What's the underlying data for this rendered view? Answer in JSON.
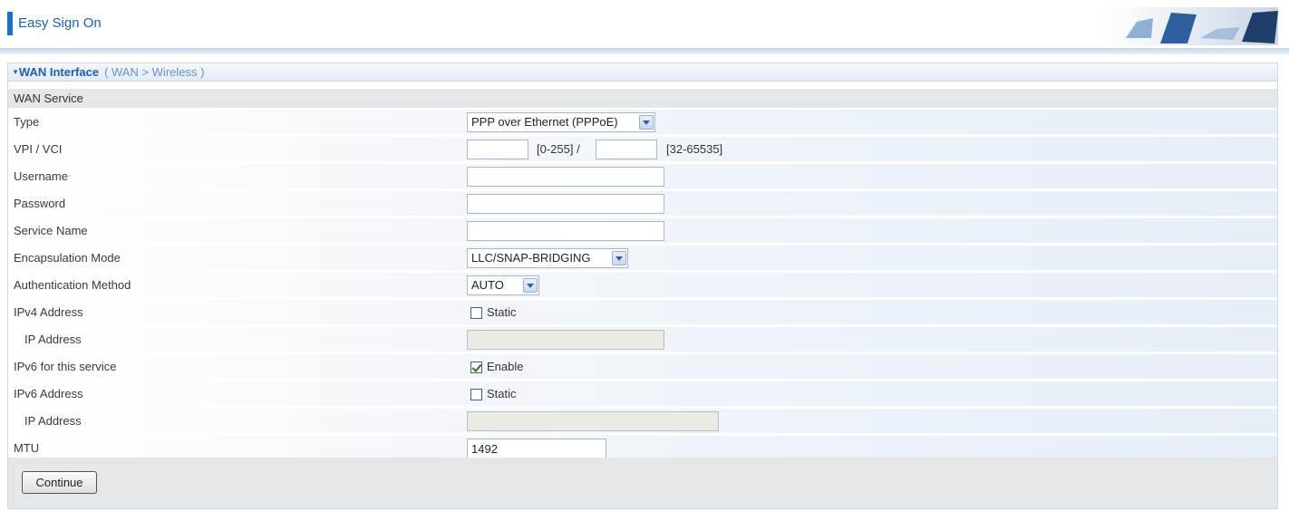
{
  "header": {
    "title": "Easy Sign On"
  },
  "panel": {
    "title": "WAN Interface",
    "breadcrumb": "( WAN > Wireless )",
    "section_title": "WAN Service"
  },
  "form": {
    "type": {
      "label": "Type",
      "value": "PPP over Ethernet (PPPoE)"
    },
    "vpi_vci": {
      "label": "VPI / VCI",
      "vpi_value": "",
      "vpi_range": "[0-255] /",
      "vci_value": "",
      "vci_range": "[32-65535]"
    },
    "username": {
      "label": "Username",
      "value": ""
    },
    "password": {
      "label": "Password",
      "value": ""
    },
    "service_name": {
      "label": "Service Name",
      "value": ""
    },
    "encapsulation": {
      "label": "Encapsulation Mode",
      "value": "LLC/SNAP-BRIDGING"
    },
    "auth": {
      "label": "Authentication Method",
      "value": "AUTO"
    },
    "ipv4": {
      "label": "IPv4 Address",
      "checkbox_label": "Static",
      "checked": false
    },
    "ipv4_ip": {
      "label": "IP Address",
      "value": ""
    },
    "ipv6_service": {
      "label": "IPv6 for this service",
      "checkbox_label": "Enable",
      "checked": true
    },
    "ipv6": {
      "label": "IPv6 Address",
      "checkbox_label": "Static",
      "checked": false
    },
    "ipv6_ip": {
      "label": "IP Address",
      "value": ""
    },
    "mtu": {
      "label": "MTU",
      "value": "1492"
    }
  },
  "buttons": {
    "continue": "Continue"
  },
  "colors": {
    "accent": "#1e6fc2",
    "title_text": "#1e5fab",
    "breadcrumb_text": "#6b92c2",
    "section_bg": "#e4e6e8"
  }
}
